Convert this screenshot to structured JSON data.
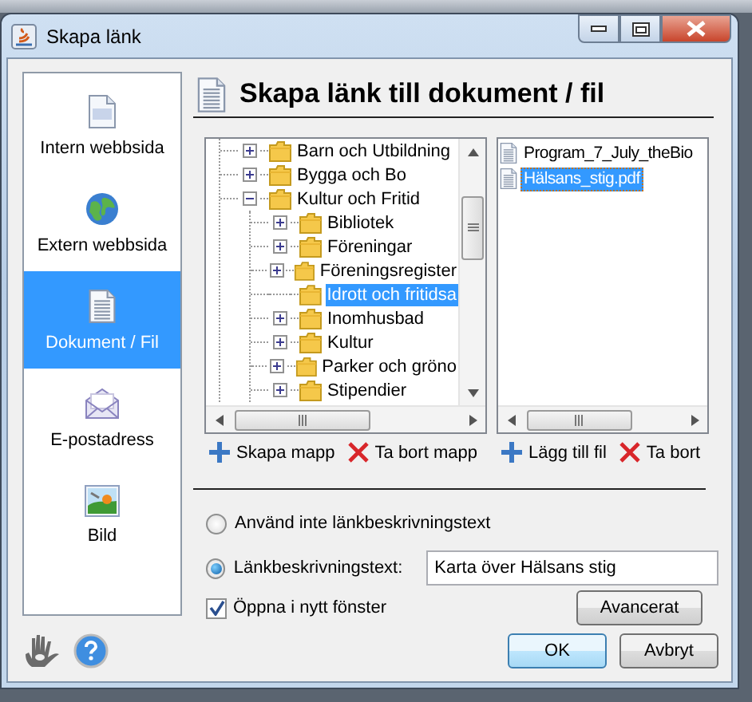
{
  "window": {
    "title": "Skapa länk"
  },
  "sidebar": {
    "items": [
      {
        "label": "Intern webbsida",
        "kind": "page",
        "selected": false
      },
      {
        "label": "Extern webbsida",
        "kind": "globe",
        "selected": false
      },
      {
        "label": "Dokument / Fil",
        "kind": "document",
        "selected": true
      },
      {
        "label": "E-postadress",
        "kind": "envelope",
        "selected": false
      },
      {
        "label": "Bild",
        "kind": "image",
        "selected": false
      }
    ]
  },
  "heading": "Skapa länk till dokument / fil",
  "tree": {
    "nodes": [
      {
        "label": "Barn och Utbildning",
        "expanded": false,
        "selected": false
      },
      {
        "label": "Bygga och Bo",
        "expanded": false,
        "selected": false
      },
      {
        "label": "Kultur och Fritid",
        "expanded": true,
        "selected": false,
        "children": [
          {
            "label": "Bibliotek",
            "expanded": false,
            "selected": false
          },
          {
            "label": "Föreningar",
            "expanded": false,
            "selected": false
          },
          {
            "label": "Föreningsregister",
            "expanded": false,
            "selected": false
          },
          {
            "label": "Idrott och fritidsa",
            "selected": true
          },
          {
            "label": "Inomhusbad",
            "expanded": false,
            "selected": false
          },
          {
            "label": "Kultur",
            "expanded": false,
            "selected": false
          },
          {
            "label": "Parker och gröno",
            "expanded": false,
            "selected": false
          },
          {
            "label": "Stipendier",
            "expanded": false,
            "selected": false
          }
        ]
      }
    ]
  },
  "files": [
    {
      "name": "Program_7_July_theBio",
      "selected": false
    },
    {
      "name": "Hälsans_stig.pdf",
      "selected": true
    }
  ],
  "folder_actions": [
    {
      "label": "Skapa mapp",
      "kind": "add"
    },
    {
      "label": "Ta bort mapp",
      "kind": "remove"
    }
  ],
  "file_actions": [
    {
      "label": "Lägg till fil",
      "kind": "add"
    },
    {
      "label": "Ta bort",
      "kind": "remove"
    }
  ],
  "link_text_options": [
    {
      "label": "Använd inte länkbeskrivningstext",
      "selected": false
    },
    {
      "label": "Länkbeskrivningstext:",
      "selected": true,
      "field": {
        "value": "Karta över Hälsans stig"
      }
    }
  ],
  "open_in_new_window": {
    "label": "Öppna i nytt fönster",
    "checked": true
  },
  "advanced_button": "Avancerat",
  "buttons": [
    {
      "label": "OK",
      "default": true
    },
    {
      "label": "Avbryt",
      "default": false
    }
  ]
}
